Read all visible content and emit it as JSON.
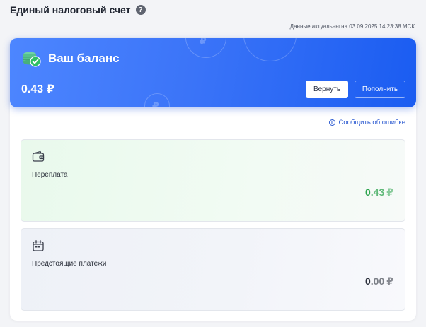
{
  "header": {
    "title": "Единый налоговый счет",
    "help_icon": "question-circle-icon",
    "help_glyph": "?"
  },
  "updated_text": "Данные актуальны на 03.09.2025 14:23:38 МСК",
  "balance": {
    "title": "Ваш баланс",
    "amount": "0.43 ₽",
    "return_label": "Вернуть",
    "topup_label": "Пополнить",
    "icon": "coins-check-icon"
  },
  "report_error": {
    "label": "Сообщить об ошибке",
    "icon": "info-circle-icon",
    "glyph": "i"
  },
  "cards": {
    "overpayment": {
      "label": "Переплата",
      "value_main": "0",
      "value_rest": ".43",
      "currency": "₽",
      "icon": "wallet-icon"
    },
    "upcoming": {
      "label": "Предстоящие платежи",
      "value_main": "0",
      "value_rest": ".00",
      "currency": "₽",
      "icon": "calendar-icon"
    }
  },
  "colors": {
    "accent_blue": "#3b74f8",
    "link_blue": "#2d5bd1",
    "success_green": "#2ea44f"
  }
}
